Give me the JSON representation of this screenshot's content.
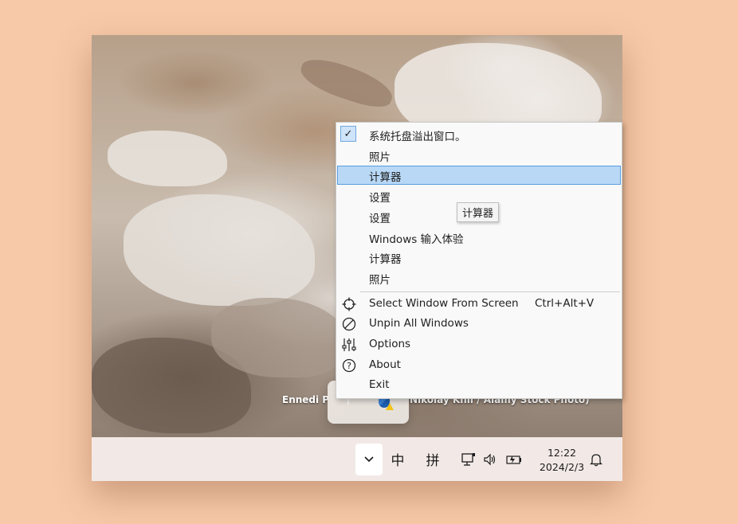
{
  "desktop": {
    "caption_left": "Ennedi P",
    "caption_right": "Nikolay Khil / Alamy Stock Photo)"
  },
  "context_menu": {
    "items": [
      {
        "label": "系统托盘溢出窗口。",
        "checked": true
      },
      {
        "label": "照片"
      },
      {
        "label": "计算器",
        "highlighted": true
      },
      {
        "label": "设置"
      },
      {
        "label": "设置"
      },
      {
        "label": "Windows 输入体验"
      },
      {
        "label": "计算器"
      },
      {
        "label": "照片"
      }
    ],
    "commands": [
      {
        "label": "Select Window From Screen",
        "shortcut": "Ctrl+Alt+V",
        "icon": "crosshair-icon"
      },
      {
        "label": "Unpin All Windows",
        "icon": "unpin-icon"
      },
      {
        "label": "Options",
        "icon": "sliders-icon"
      },
      {
        "label": "About",
        "icon": "help-icon"
      },
      {
        "label": "Exit"
      }
    ]
  },
  "tooltip": {
    "text": "计算器"
  },
  "taskbar": {
    "ime_mode": "中",
    "ime_input": "拼",
    "time": "12:22",
    "date": "2024/2/3"
  },
  "colors": {
    "page_background": "#f7c9a8",
    "highlight": "#b8d8f6",
    "highlight_border": "#5a9ee0",
    "taskbar": "#f2e9e6"
  }
}
